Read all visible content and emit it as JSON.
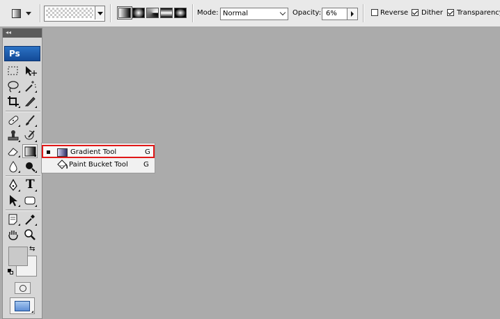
{
  "options_bar": {
    "mode_label": "Mode:",
    "mode_value": "Normal",
    "opacity_label": "Opacity:",
    "opacity_value": "6%",
    "reverse_label": "Reverse",
    "reverse_checked": false,
    "dither_label": "Dither",
    "dither_checked": true,
    "transparency_label": "Transparency",
    "transparency_checked": true,
    "gradient_types": [
      "linear",
      "radial",
      "angle",
      "reflected",
      "diamond"
    ],
    "selected_gradient_type": "linear"
  },
  "toolbox": {
    "collapse_label": "◂◂",
    "logo": "Ps",
    "text_tool_glyph": "T",
    "swap_glyph": "⇆"
  },
  "flyout": {
    "items": [
      {
        "name": "Gradient Tool",
        "shortcut": "G",
        "selected": true,
        "icon": "gradient-icon"
      },
      {
        "name": "Paint Bucket Tool",
        "shortcut": "G",
        "selected": false,
        "icon": "paint-bucket-icon"
      }
    ]
  },
  "colors": {
    "canvas": "#ababab",
    "highlight": "#e01818",
    "ps_blue": "#134a97"
  }
}
